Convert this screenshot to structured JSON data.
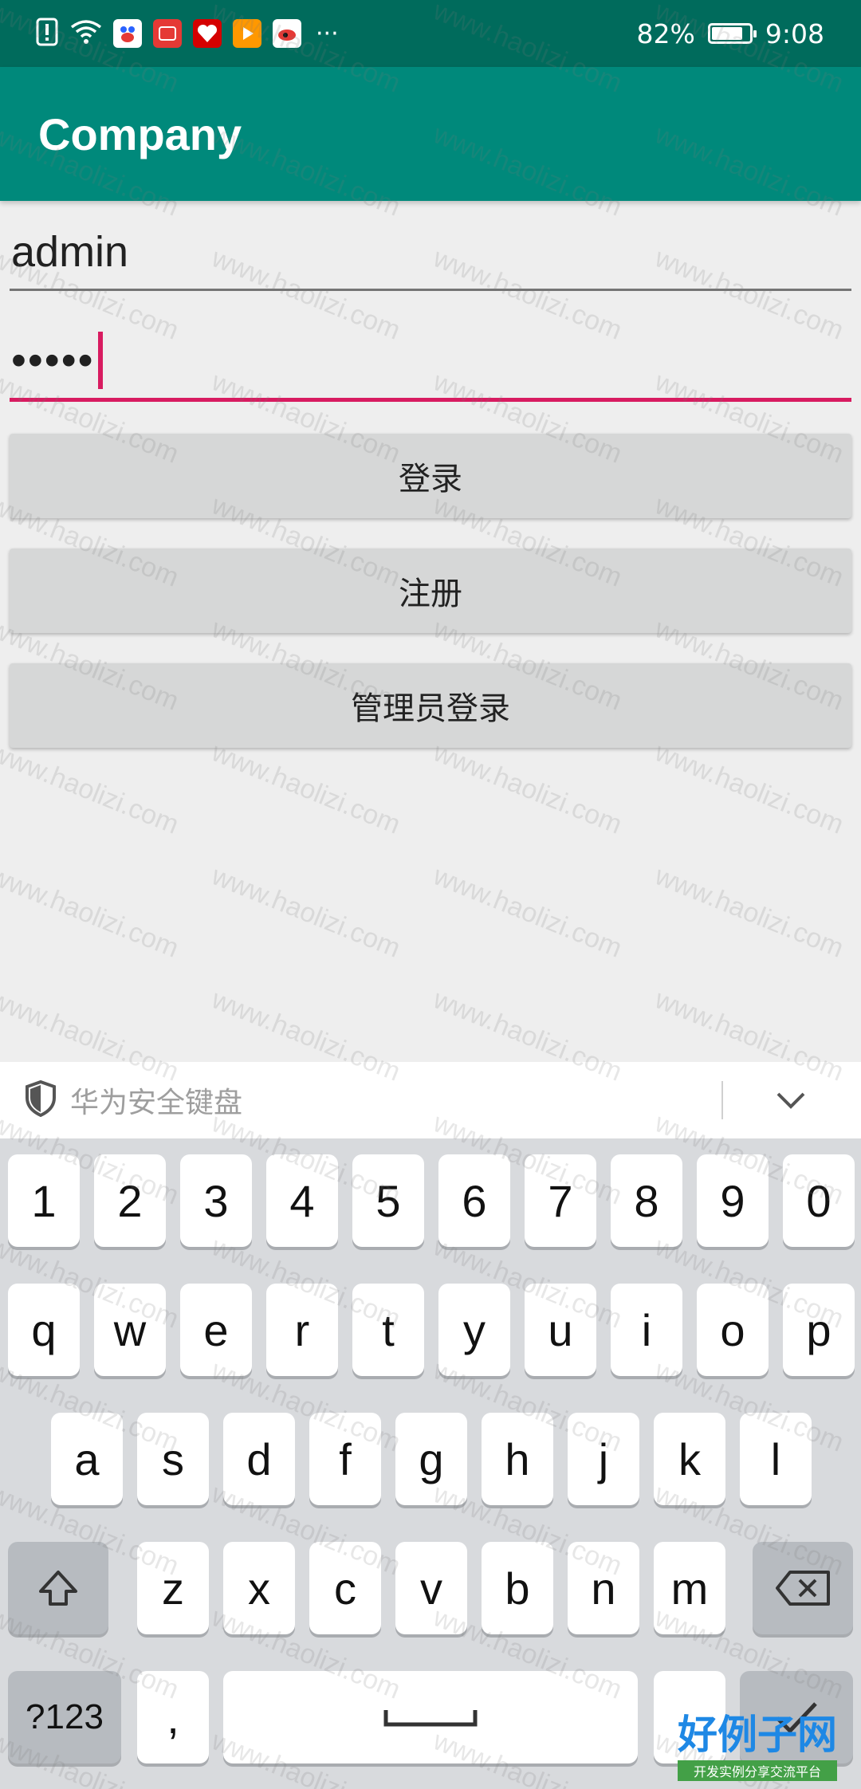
{
  "status_bar": {
    "battery": "82%",
    "battery_level": 0.82,
    "time": "9:08",
    "more": "···",
    "notification_icons": [
      "alert-icon",
      "wifi-icon",
      "baidu-app-icon",
      "huawei-app-icon",
      "heart-app-icon",
      "video-app-icon",
      "sina-app-icon"
    ]
  },
  "app_bar": {
    "title": "Company"
  },
  "form": {
    "username_value": "admin",
    "password_value": "•••••"
  },
  "buttons": {
    "login": "登录",
    "register": "注册",
    "admin_login": "管理员登录"
  },
  "keyboard": {
    "header_label": "华为安全键盘",
    "row_numbers": [
      "1",
      "2",
      "3",
      "4",
      "5",
      "6",
      "7",
      "8",
      "9",
      "0"
    ],
    "row_top": [
      "q",
      "w",
      "e",
      "r",
      "t",
      "y",
      "u",
      "i",
      "o",
      "p"
    ],
    "row_middle": [
      "a",
      "s",
      "d",
      "f",
      "g",
      "h",
      "j",
      "k",
      "l"
    ],
    "row_bottom": [
      "z",
      "x",
      "c",
      "v",
      "b",
      "n",
      "m"
    ],
    "symbols_key": "?123",
    "comma_key": ","
  },
  "watermark": {
    "text": "www.haolizi.com",
    "brand": "好例子网",
    "brand_sub": "开发实例分享交流平台"
  },
  "colors": {
    "status_bar": "#006b5c",
    "app_bar": "#00897b",
    "accent": "#d81b60",
    "background": "#eeeeee"
  }
}
